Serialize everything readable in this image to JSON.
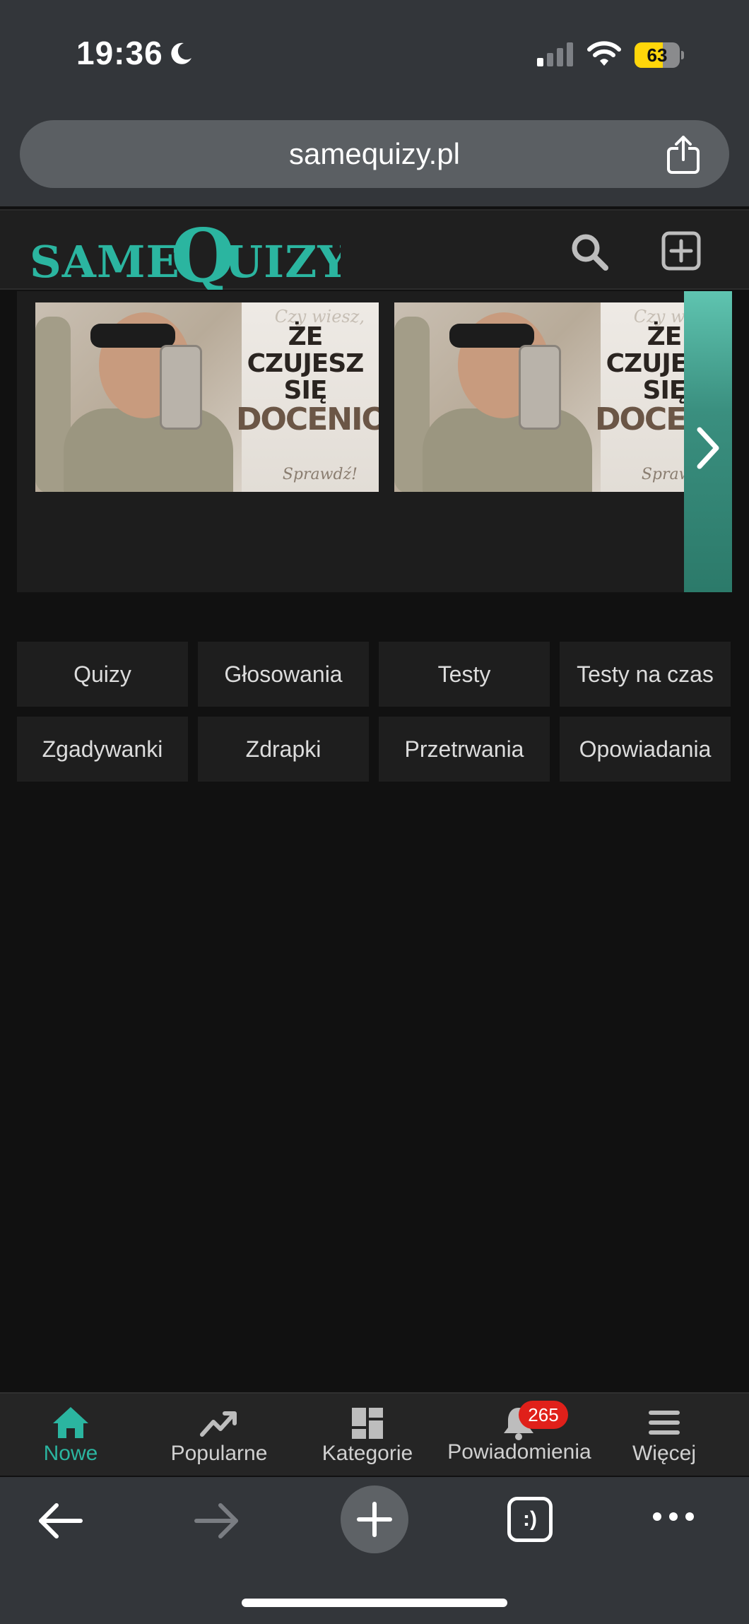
{
  "status_bar": {
    "time": "19:36",
    "battery": "63",
    "battery_level": 0.63
  },
  "browser": {
    "url": "samequizy.pl"
  },
  "site": {
    "logo": {
      "part1": "SAME",
      "part2": "QUIZY"
    },
    "accent": "#2bb5a0"
  },
  "carousel": {
    "slides": [
      {
        "script_top": "Czy wiesz,",
        "line1": "ŻE CZUJESZ SIĘ",
        "line2": "DOCENIONY?",
        "script_bottom": "Sprawdź!"
      },
      {
        "script_top": "Czy wiesz,",
        "line1": "ŻE CZUJESZ SIĘ",
        "line2": "DOCENIONY?",
        "script_bottom": "Sprawdź!"
      }
    ]
  },
  "categories": [
    "Quizy",
    "Głosowania",
    "Testy",
    "Testy na czas",
    "Zgadywanki",
    "Zdrapki",
    "Przetrwania",
    "Opowiadania"
  ],
  "bottom_nav": {
    "items": [
      {
        "label": "Nowe",
        "icon": "home-icon"
      },
      {
        "label": "Popularne",
        "icon": "trending-icon"
      },
      {
        "label": "Kategorie",
        "icon": "grid-icon"
      },
      {
        "label": "Powiadomienia",
        "icon": "bell-icon"
      },
      {
        "label": "Więcej",
        "icon": "menu-icon"
      }
    ],
    "notifications_count": "265"
  },
  "safari_toolbar": {
    "tabs_label": ":)"
  }
}
